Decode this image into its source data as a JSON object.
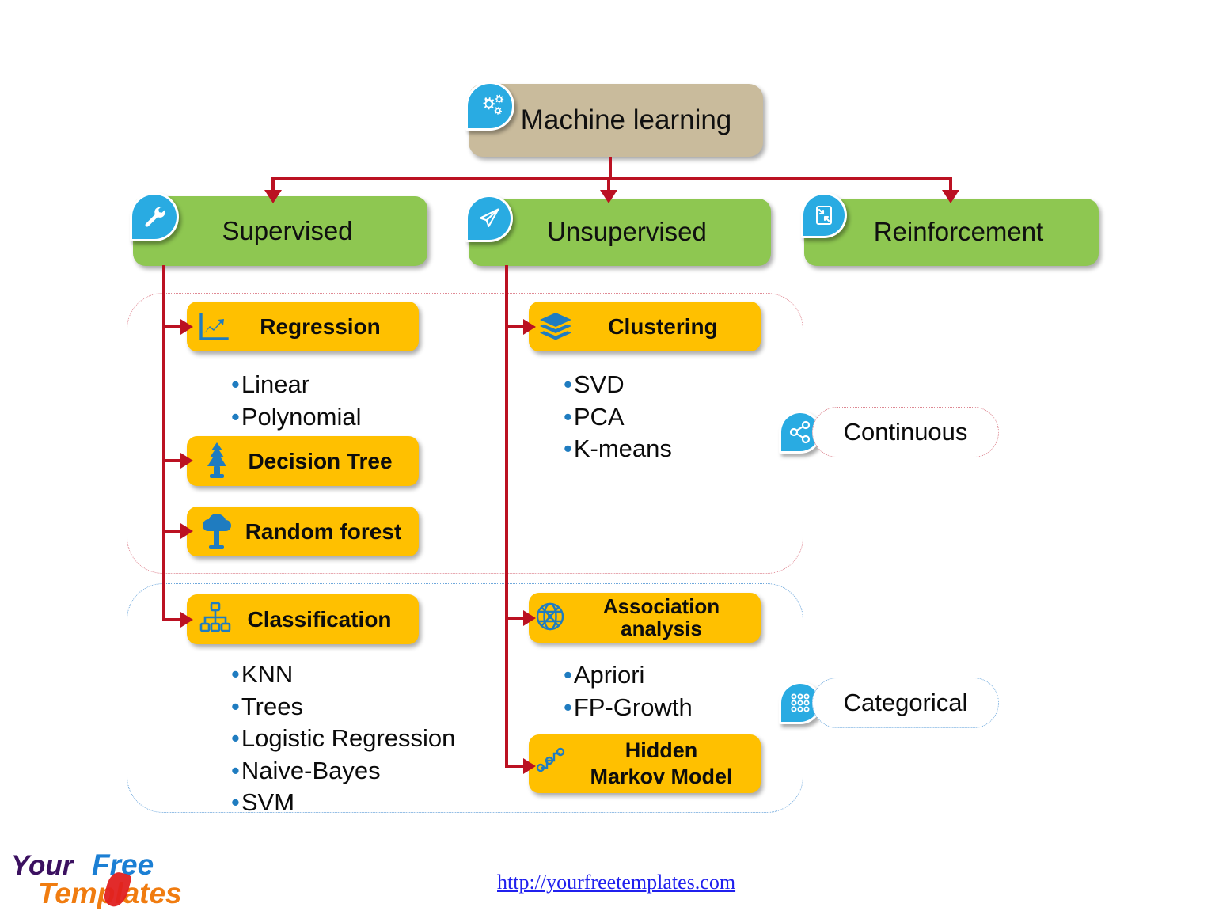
{
  "diagram": {
    "title": "Machine learning",
    "root": {
      "label": "Machine learning",
      "icon": "gears-icon",
      "color": "#c9bb9c"
    },
    "categories": [
      {
        "label": "Supervised",
        "icon": "wrench-icon",
        "color": "#8ec751"
      },
      {
        "label": "Unsupervised",
        "icon": "paper-plane-icon",
        "color": "#8ec751"
      },
      {
        "label": "Reinforcement",
        "icon": "compress-icon",
        "color": "#8ec751"
      }
    ],
    "leaves": {
      "regression": {
        "label": "Regression",
        "icon": "line-chart-icon",
        "bullets": [
          "Linear",
          "Polynomial"
        ]
      },
      "decision_tree": {
        "label": "Decision Tree",
        "icon": "pine-tree-icon",
        "bullets": []
      },
      "random_forest": {
        "label": "Random forest",
        "icon": "tree-icon",
        "bullets": []
      },
      "classification": {
        "label": "Classification",
        "icon": "hierarchy-icon",
        "bullets": [
          "KNN",
          "Trees",
          "Logistic Regression",
          "Naive-Bayes",
          "SVM"
        ]
      },
      "clustering": {
        "label": "Clustering",
        "icon": "layers-icon",
        "bullets": [
          "SVD",
          "PCA",
          "K-means"
        ]
      },
      "association": {
        "label": "Association analysis",
        "icon": "globe-network-icon",
        "bullets": [
          "Apriori",
          "FP-Growth"
        ]
      },
      "hmm": {
        "label": "Hidden\nMarkov Model",
        "icon": "node-path-icon",
        "bullets": []
      }
    },
    "callouts": [
      {
        "label": "Continuous",
        "icon": "share-nodes-icon",
        "outline": "#dd8892"
      },
      {
        "label": "Categorical",
        "icon": "dot-grid-icon",
        "outline": "#7ab0e0"
      }
    ],
    "bullet_dot": "•",
    "colors": {
      "root_fill": "#c9bb9c",
      "category_fill": "#8ec751",
      "leaf_fill": "#ffc000",
      "connector": "#bb1122",
      "icon_badge": "#29abe2",
      "icon_blue": "#1f7cc0",
      "group_red": "#e08a95",
      "group_blue": "#6fa8dc"
    }
  },
  "footer": {
    "url": "http://yourfreetemplates.com",
    "logo": {
      "word1": "Your",
      "word2": "Free",
      "word3": "Templates"
    }
  }
}
